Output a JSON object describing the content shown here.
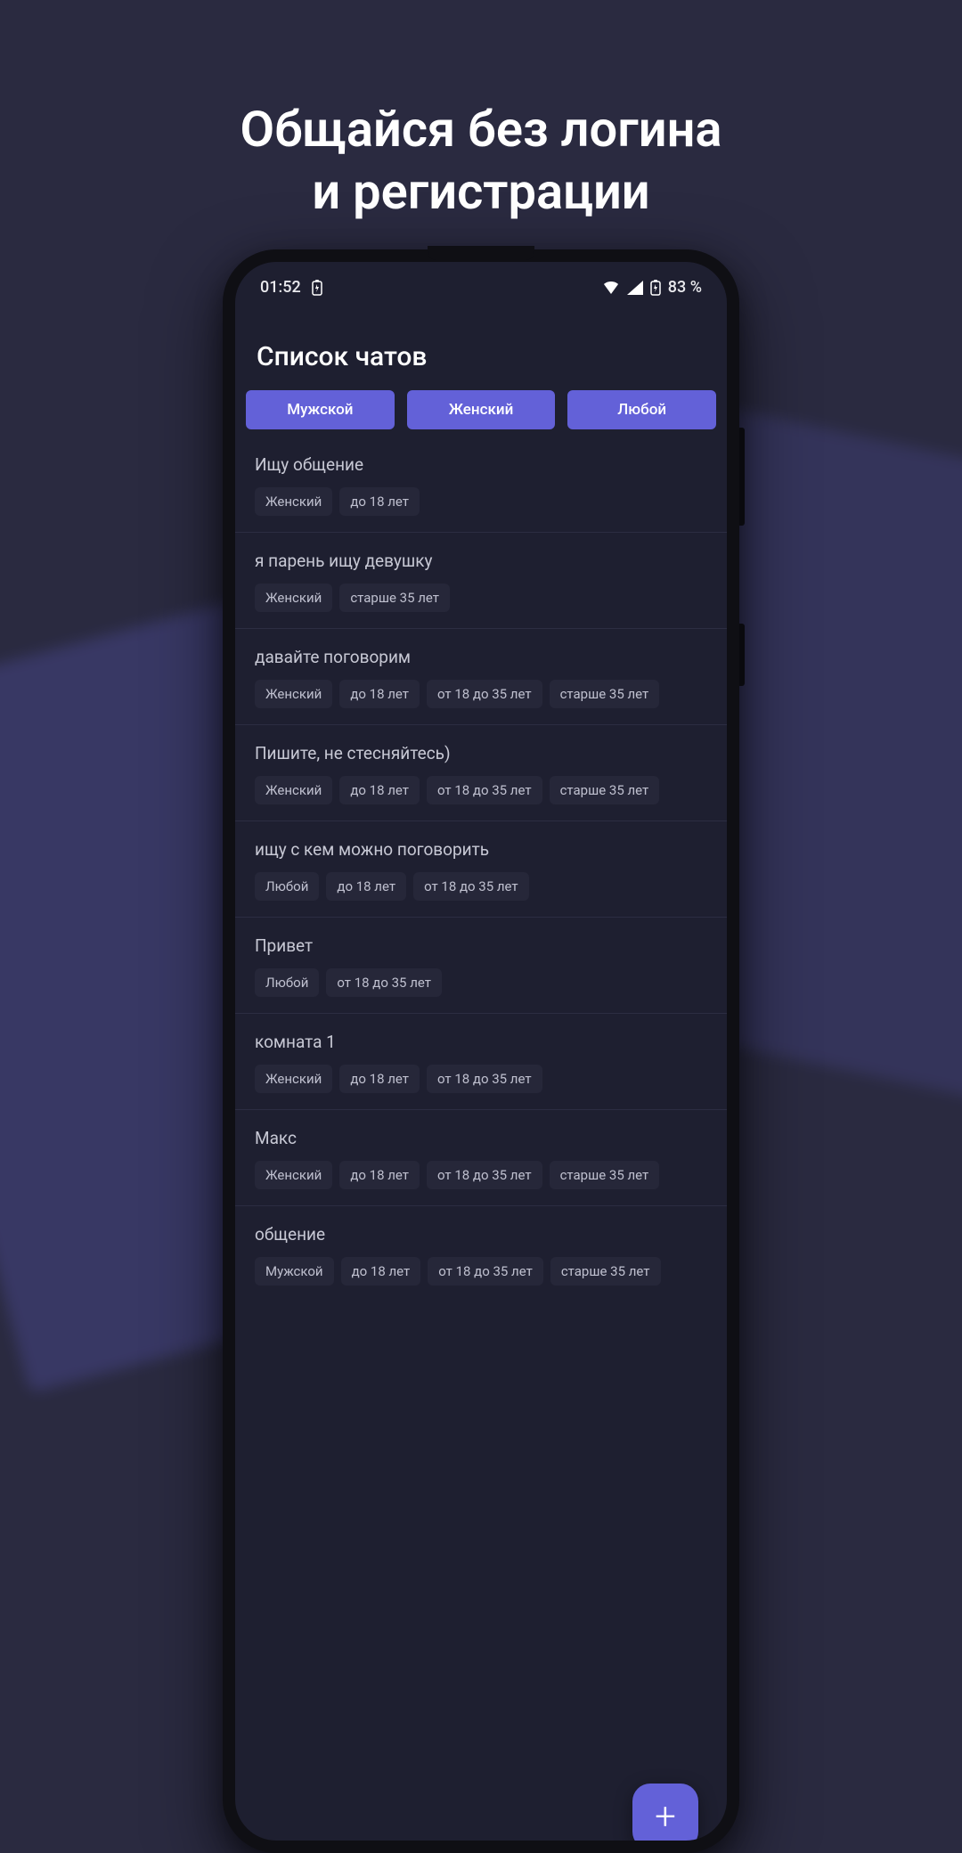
{
  "promo": {
    "line1": "Общайся без логина",
    "line2": "и регистрации"
  },
  "status": {
    "time": "01:52",
    "battery_pct": "83 %"
  },
  "page": {
    "title": "Список чатов"
  },
  "filters": {
    "tab0": "Мужской",
    "tab1": "Женский",
    "tab2": "Любой"
  },
  "chats": [
    {
      "title": "Ищу общение",
      "tags": [
        "Женский",
        "до 18 лет"
      ]
    },
    {
      "title": "я парень ищу девушку",
      "tags": [
        "Женский",
        "старше 35 лет"
      ]
    },
    {
      "title": "давайте поговорим",
      "tags": [
        "Женский",
        "до 18 лет",
        "от 18 до 35 лет",
        "старше 35 лет"
      ]
    },
    {
      "title": "Пишите, не стесняйтесь)",
      "tags": [
        "Женский",
        "до 18 лет",
        "от 18 до 35 лет",
        "старше 35 лет"
      ]
    },
    {
      "title": "ищу с кем можно поговорить",
      "tags": [
        "Любой",
        "до 18 лет",
        "от 18 до 35 лет"
      ]
    },
    {
      "title": "Привет",
      "tags": [
        "Любой",
        "от 18 до 35 лет"
      ]
    },
    {
      "title": "комната 1",
      "tags": [
        "Женский",
        "до 18 лет",
        "от 18 до 35 лет"
      ]
    },
    {
      "title": "Макс",
      "tags": [
        "Женский",
        "до 18 лет",
        "от 18 до 35 лет",
        "старше 35 лет"
      ]
    },
    {
      "title": "общение",
      "tags": [
        "Мужской",
        "до 18 лет",
        "от 18 до 35 лет",
        "старше 35 лет"
      ]
    }
  ],
  "fab": {
    "label": "+"
  }
}
